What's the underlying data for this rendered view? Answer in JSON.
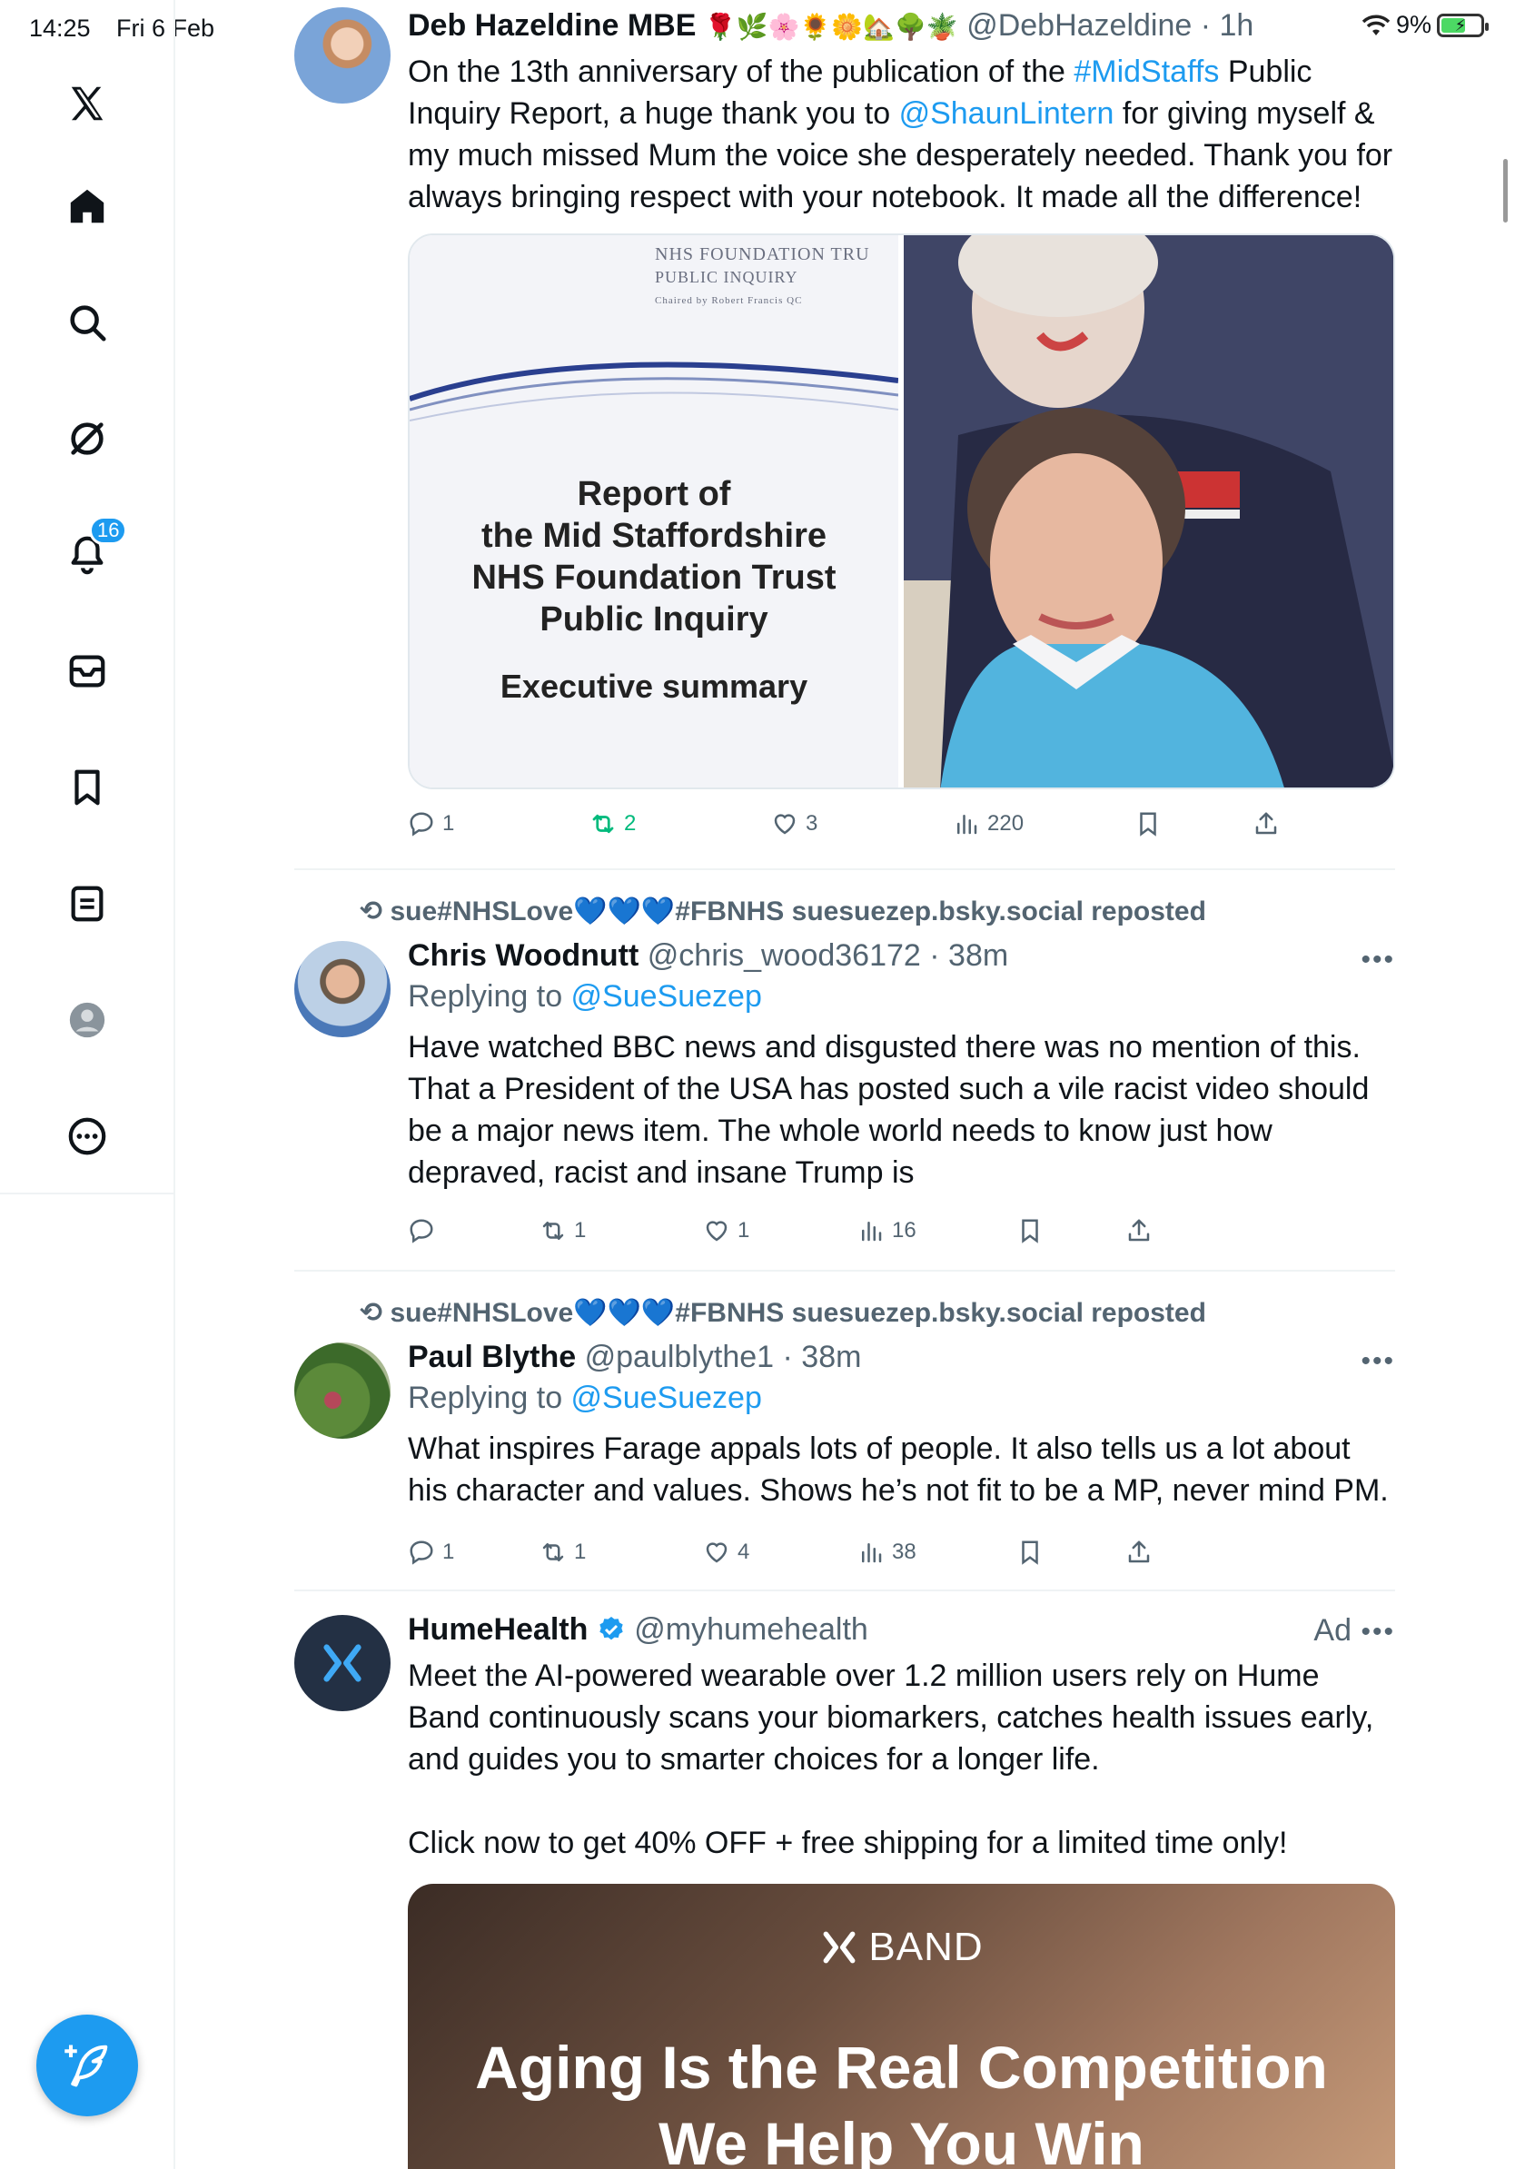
{
  "status_bar": {
    "time": "14:25",
    "date": "Fri 6 Feb",
    "battery": "9%"
  },
  "sidebar": {
    "items": [
      {
        "name": "x-logo-icon"
      },
      {
        "name": "home-icon"
      },
      {
        "name": "search-icon"
      },
      {
        "name": "grok-icon"
      },
      {
        "name": "notifications-icon",
        "badge": "16"
      },
      {
        "name": "messages-icon"
      },
      {
        "name": "bookmarks-icon"
      },
      {
        "name": "lists-icon"
      },
      {
        "name": "profile-icon"
      },
      {
        "name": "more-icon"
      }
    ]
  },
  "posts": [
    {
      "name": "Deb Hazeldine MBE",
      "emojis": "🌹🌿🌸🌻🌼🏡🌳🪴",
      "handle": "@DebHazeldine",
      "time": "· 1h",
      "text_1": "On the 13th anniversary of the publication of the ",
      "link_1": "#MidStaffs",
      "text_2": " Public Inquiry Report,  a huge thank you to ",
      "link_2": "@ShaunLintern",
      "text_3": " for giving myself & my much missed Mum the voice she desperately needed. Thank you for always bringing respect with your notebook. It made all the difference!",
      "media": {
        "org": "NHS FOUNDATION TRU",
        "sub": "PUBLIC INQUIRY",
        "chair": "Chaired by Robert Francis QC",
        "title_lines": [
          "Report of",
          "the Mid Staffordshire",
          "NHS Foundation Trust",
          "Public Inquiry"
        ],
        "subtitle": "Executive summary"
      },
      "actions": {
        "replies": "1",
        "reposts": "2",
        "likes": "3",
        "views": "220"
      }
    },
    {
      "repost_by": "sue#NHSLove💙💙💙#FBNHS suesuezep.bsky.social reposted",
      "name": "Chris Woodnutt",
      "handle": "@chris_wood36172",
      "time": "· 38m",
      "reply_prefix": "Replying to ",
      "reply_to": "@SueSuezep",
      "text": "Have watched BBC news and disgusted there was no mention of this. That a President of the USA has posted such a vile racist video should be a major news item. The whole world needs to know just how depraved, racist and insane Trump is",
      "actions": {
        "replies": "",
        "reposts": "1",
        "likes": "1",
        "views": "16"
      }
    },
    {
      "repost_by": "sue#NHSLove💙💙💙#FBNHS suesuezep.bsky.social reposted",
      "name": "Paul Blythe",
      "handle": "@paulblythe1",
      "time": "· 38m",
      "reply_prefix": "Replying to ",
      "reply_to": "@SueSuezep",
      "text": "What inspires Farage appals lots of people. It also tells us a lot about his character and values. Shows he’s not fit to be a MP, never mind PM.",
      "actions": {
        "replies": "1",
        "reposts": "1",
        "likes": "4",
        "views": "38"
      }
    },
    {
      "name": "HumeHealth",
      "handle": "@myhumehealth",
      "ad_label": "Ad",
      "text_1": "Meet the AI-powered wearable over 1.2 million users rely on Hume Band continuously scans your biomarkers, catches health issues early, and guides you to smarter choices for a longer life.",
      "text_2": "Click now to get 40% OFF + free shipping for a limited time only!",
      "media": {
        "brand": "BAND",
        "headline_1": "Aging Is the Real Competition",
        "headline_2": "We Help You Win"
      }
    }
  ]
}
